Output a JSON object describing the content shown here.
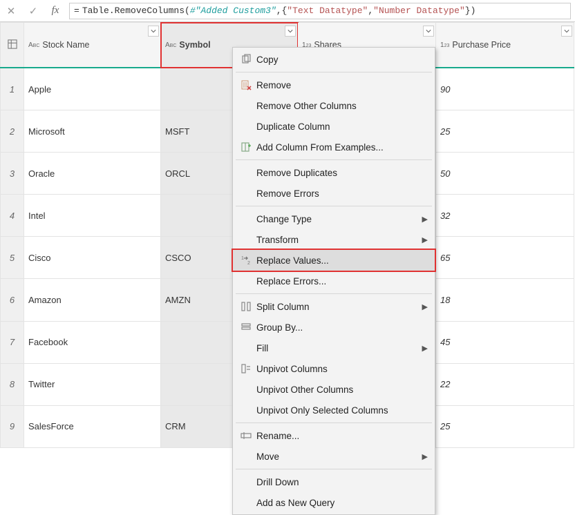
{
  "formula": {
    "fn": "Table.RemoveColumns",
    "var": "#\"Added Custom3\"",
    "str1": "\"Text Datatype\"",
    "str2": "\"Number Datatype\""
  },
  "columns": {
    "c1": "Stock Name",
    "c2": "Symbol",
    "c3": "Shares",
    "c4": "Purchase Price"
  },
  "rows": [
    {
      "n": "1",
      "stock": "Apple",
      "sym": "",
      "shares": "",
      "price": "90"
    },
    {
      "n": "2",
      "stock": "Microsoft",
      "sym": "MSFT",
      "shares": "",
      "price": "25"
    },
    {
      "n": "3",
      "stock": "Oracle",
      "sym": "ORCL",
      "shares": "",
      "price": "50"
    },
    {
      "n": "4",
      "stock": "Intel",
      "sym": "",
      "shares": "",
      "price": "32"
    },
    {
      "n": "5",
      "stock": "Cisco",
      "sym": "CSCO",
      "shares": "",
      "price": "65"
    },
    {
      "n": "6",
      "stock": "Amazon",
      "sym": "AMZN",
      "shares": "",
      "price": "18"
    },
    {
      "n": "7",
      "stock": "Facebook",
      "sym": "",
      "shares": "",
      "price": "45"
    },
    {
      "n": "8",
      "stock": "Twitter",
      "sym": "",
      "shares": "",
      "price": "22"
    },
    {
      "n": "9",
      "stock": "SalesForce",
      "sym": "CRM",
      "shares": "",
      "price": "25"
    }
  ],
  "menu": {
    "copy": "Copy",
    "remove": "Remove",
    "removeOther": "Remove Other Columns",
    "duplicate": "Duplicate Column",
    "addFromEx": "Add Column From Examples...",
    "removeDup": "Remove Duplicates",
    "removeErr": "Remove Errors",
    "changeType": "Change Type",
    "transform": "Transform",
    "replaceVal": "Replace Values...",
    "replaceErr": "Replace Errors...",
    "split": "Split Column",
    "group": "Group By...",
    "fill": "Fill",
    "unpivot": "Unpivot Columns",
    "unpivotOther": "Unpivot Other Columns",
    "unpivotSel": "Unpivot Only Selected Columns",
    "rename": "Rename...",
    "move": "Move",
    "drill": "Drill Down",
    "addNew": "Add as New Query"
  }
}
